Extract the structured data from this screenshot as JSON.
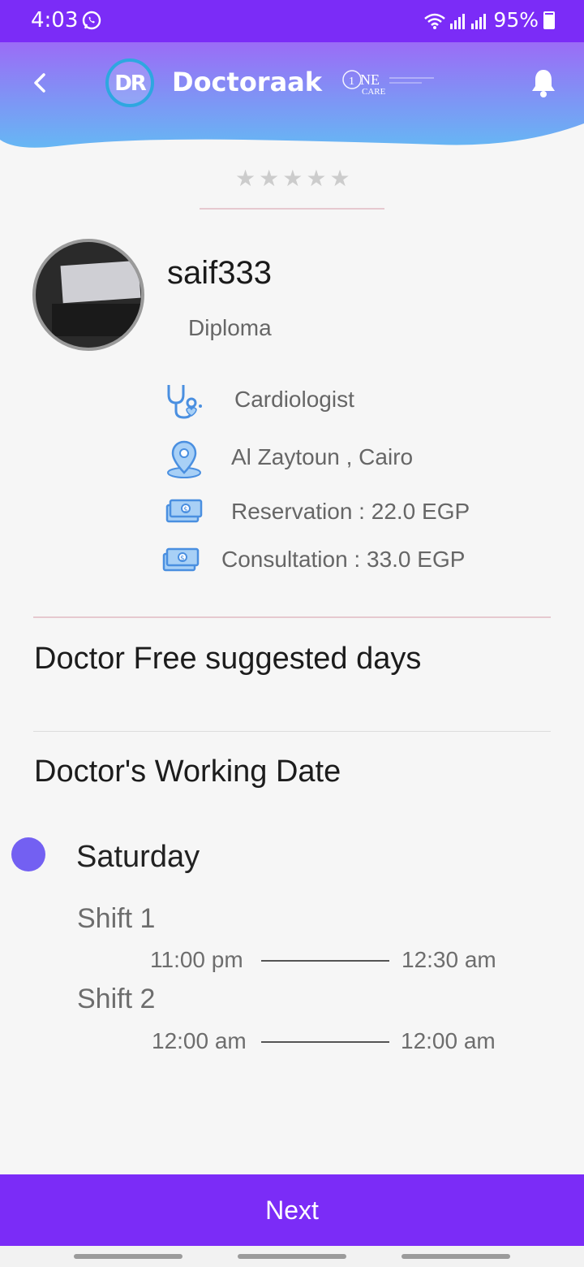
{
  "status_bar": {
    "time": "4:03",
    "battery": "95%",
    "icons": [
      "whatsapp-icon",
      "wifi-icon",
      "signal-icon",
      "battery-icon"
    ]
  },
  "header": {
    "logo_text": "DR",
    "title": "Doctoraak",
    "partner_logo": "ONE CARE",
    "colors": {
      "gradient_top": "#9b6cf6",
      "gradient_bottom": "#66b7f4",
      "accent": "#7b2cf7"
    }
  },
  "rating": {
    "stars": 0,
    "max": 5
  },
  "doctor": {
    "name": "saif333",
    "degree": "Diploma",
    "specialty": "Cardiologist",
    "location": "Al Zaytoun , Cairo",
    "reservation": "Reservation : 22.0 EGP",
    "consultation": "Consultation : 33.0 EGP"
  },
  "sections": {
    "free_days_title": "Doctor Free suggested days",
    "working_date_title": "Doctor's Working Date"
  },
  "schedule": {
    "day": "Saturday",
    "shifts": [
      {
        "label": "Shift 1",
        "from": "11:00 pm",
        "to": "12:30 am"
      },
      {
        "label": "Shift 2",
        "from": "12:00 am",
        "to": "12:00 am"
      }
    ]
  },
  "footer": {
    "next_label": "Next"
  }
}
